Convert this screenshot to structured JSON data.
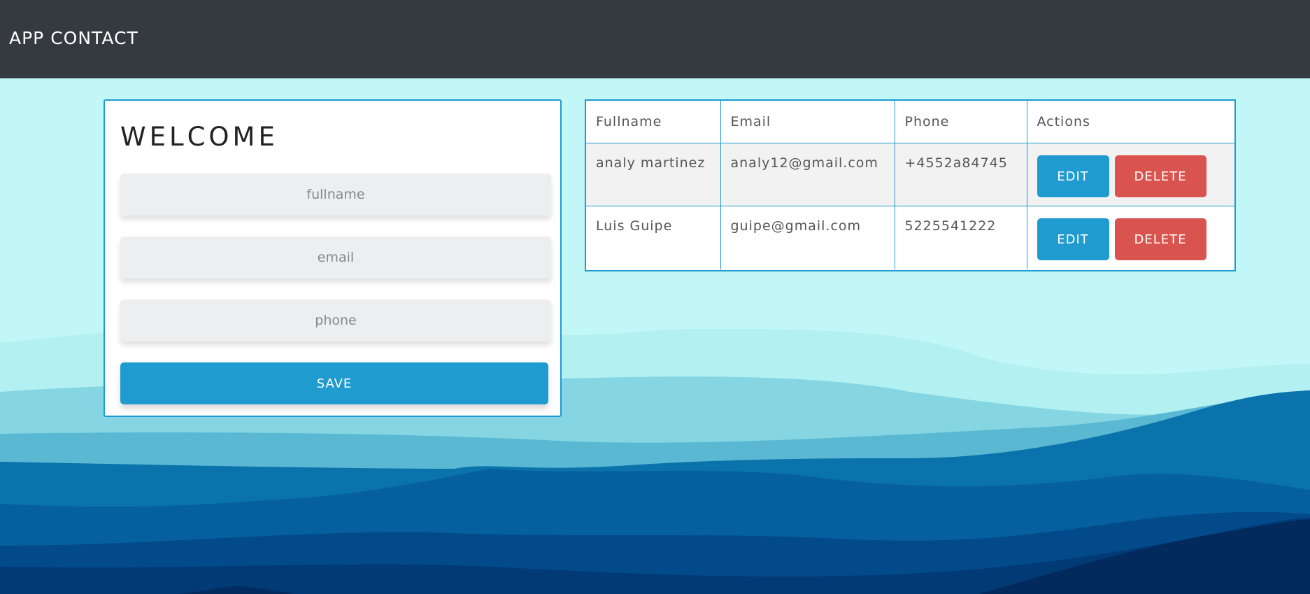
{
  "app": {
    "title": "APP CONTACT"
  },
  "form": {
    "heading": "WELCOME",
    "fullname_placeholder": "fullname",
    "email_placeholder": "email",
    "phone_placeholder": "phone",
    "save_label": "SAVE"
  },
  "table": {
    "headers": [
      "Fullname",
      "Email",
      "Phone",
      "Actions"
    ],
    "rows": [
      {
        "fullname": "analy martinez",
        "email": "analy12@gmail.com",
        "phone": "+4552a84745",
        "edit_label": "EDIT",
        "delete_label": "DELETE"
      },
      {
        "fullname": "Luis Guipe",
        "email": "guipe@gmail.com",
        "phone": "5225541222",
        "edit_label": "EDIT",
        "delete_label": "DELETE"
      }
    ]
  },
  "colors": {
    "navbar": "#343a40",
    "accent": "#1f9bd0",
    "danger": "#d9534f",
    "background": "#c2f7f7"
  }
}
